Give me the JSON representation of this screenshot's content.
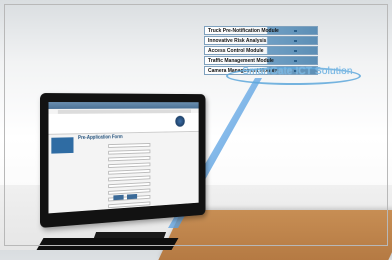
{
  "modules": [
    "Truck Pre-Notification Module",
    "Innovative Risk Analysis",
    "Access Control Module",
    "Traffic Management Module",
    "Camera Management Module"
  ],
  "brand": {
    "title": "SmartGate ICT Solution"
  },
  "screen": {
    "logo": "",
    "form_title": "Pre-Application Form",
    "nav": [
      "",
      "",
      "",
      ""
    ],
    "sidebar_title": "",
    "fields": [
      "",
      "",
      "",
      "",
      "",
      "",
      "",
      "",
      "",
      "",
      "",
      "",
      ""
    ],
    "buttons": [
      "",
      ""
    ]
  },
  "colors": {
    "accent_blue": "#5da7da",
    "module_blue": "#5c8eb5",
    "desk_wood": "#c78e54"
  }
}
